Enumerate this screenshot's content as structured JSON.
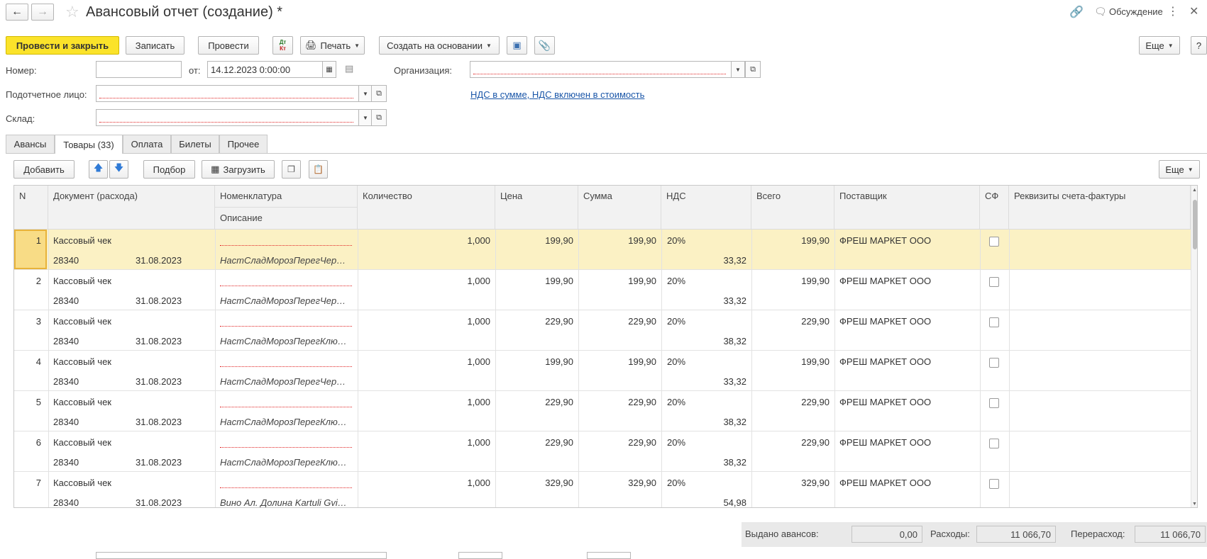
{
  "window": {
    "title": "Авансовый отчет (создание) *",
    "discussion_label": "Обсуждение"
  },
  "toolbar": {
    "post_close": "Провести и закрыть",
    "save": "Записать",
    "post": "Провести",
    "dt_kt_top": "Дт",
    "dt_kt_bottom": "Кт",
    "print": "Печать",
    "create_based": "Создать на основании",
    "more": "Еще",
    "help": "?"
  },
  "form": {
    "number_label": "Номер:",
    "number_value": "",
    "from_label": "от:",
    "date_value": "14.12.2023  0:00:00",
    "org_label": "Организация:",
    "org_value": "",
    "person_label": "Подотчетное лицо:",
    "person_value": "",
    "vat_link": "НДС в сумме, НДС включен в стоимость",
    "warehouse_label": "Склад:",
    "warehouse_value": ""
  },
  "tabs": [
    {
      "label": "Авансы",
      "active": false
    },
    {
      "label": "Товары (33)",
      "active": true
    },
    {
      "label": "Оплата",
      "active": false
    },
    {
      "label": "Билеты",
      "active": false
    },
    {
      "label": "Прочее",
      "active": false
    }
  ],
  "table_toolbar": {
    "add": "Добавить",
    "select": "Подбор",
    "load": "Загрузить",
    "more": "Еще"
  },
  "columns": {
    "n": "N",
    "doc": "Документ (расхода)",
    "nomenclature": "Номенклатура",
    "description": "Описание",
    "qty": "Количество",
    "price": "Цена",
    "sum": "Сумма",
    "vat": "НДС",
    "total": "Всего",
    "supplier": "Поставщик",
    "sf": "СФ",
    "invoice_details": "Реквизиты счета-фактуры"
  },
  "rows": [
    {
      "n": "1",
      "doc": "Кассовый чек",
      "doc_num": "28340",
      "doc_date": "31.08.2023",
      "nomenclature": "",
      "description": "НастСладМорозПерегЧер…",
      "qty": "1,000",
      "price": "199,90",
      "sum": "199,90",
      "vat_rate": "20%",
      "vat_sum": "33,32",
      "total": "199,90",
      "supplier": "ФРЕШ МАРКЕТ ООО",
      "sf": false,
      "selected": true
    },
    {
      "n": "2",
      "doc": "Кассовый чек",
      "doc_num": "28340",
      "doc_date": "31.08.2023",
      "nomenclature": "",
      "description": "НастСладМорозПерегЧер…",
      "qty": "1,000",
      "price": "199,90",
      "sum": "199,90",
      "vat_rate": "20%",
      "vat_sum": "33,32",
      "total": "199,90",
      "supplier": "ФРЕШ МАРКЕТ ООО",
      "sf": false,
      "selected": false
    },
    {
      "n": "3",
      "doc": "Кассовый чек",
      "doc_num": "28340",
      "doc_date": "31.08.2023",
      "nomenclature": "",
      "description": "НастСладМорозПерегКлю…",
      "qty": "1,000",
      "price": "229,90",
      "sum": "229,90",
      "vat_rate": "20%",
      "vat_sum": "38,32",
      "total": "229,90",
      "supplier": "ФРЕШ МАРКЕТ ООО",
      "sf": false,
      "selected": false
    },
    {
      "n": "4",
      "doc": "Кассовый чек",
      "doc_num": "28340",
      "doc_date": "31.08.2023",
      "nomenclature": "",
      "description": "НастСладМорозПерегЧер…",
      "qty": "1,000",
      "price": "199,90",
      "sum": "199,90",
      "vat_rate": "20%",
      "vat_sum": "33,32",
      "total": "199,90",
      "supplier": "ФРЕШ МАРКЕТ ООО",
      "sf": false,
      "selected": false
    },
    {
      "n": "5",
      "doc": "Кассовый чек",
      "doc_num": "28340",
      "doc_date": "31.08.2023",
      "nomenclature": "",
      "description": "НастСладМорозПерегКлю…",
      "qty": "1,000",
      "price": "229,90",
      "sum": "229,90",
      "vat_rate": "20%",
      "vat_sum": "38,32",
      "total": "229,90",
      "supplier": "ФРЕШ МАРКЕТ ООО",
      "sf": false,
      "selected": false
    },
    {
      "n": "6",
      "doc": "Кассовый чек",
      "doc_num": "28340",
      "doc_date": "31.08.2023",
      "nomenclature": "",
      "description": "НастСладМорозПерегКлю…",
      "qty": "1,000",
      "price": "229,90",
      "sum": "229,90",
      "vat_rate": "20%",
      "vat_sum": "38,32",
      "total": "229,90",
      "supplier": "ФРЕШ МАРКЕТ ООО",
      "sf": false,
      "selected": false
    },
    {
      "n": "7",
      "doc": "Кассовый чек",
      "doc_num": "28340",
      "doc_date": "31.08.2023",
      "nomenclature": "",
      "description": "Вино Ал. Долина Kartuli Gvi…",
      "qty": "1,000",
      "price": "329,90",
      "sum": "329,90",
      "vat_rate": "20%",
      "vat_sum": "54,98",
      "total": "329,90",
      "supplier": "ФРЕШ МАРКЕТ ООО",
      "sf": false,
      "selected": false
    }
  ],
  "footer": {
    "advances_label": "Выдано авансов:",
    "advances_value": "0,00",
    "expenses_label": "Расходы:",
    "expenses_value": "11 066,70",
    "overrun_label": "Перерасход:",
    "overrun_value": "11 066,70"
  },
  "colors": {
    "primary_button": "#fbe32a",
    "selected_row": "#fbf1c4",
    "link": "#1a56a8",
    "required_underline": "#e02020"
  },
  "icons": [
    "back-arrow-icon",
    "forward-arrow-icon",
    "star-icon",
    "link-icon",
    "discussion-icon",
    "printer-icon",
    "structure-icon",
    "paperclip-icon",
    "calendar-icon",
    "text-icon",
    "arrow-up-icon",
    "arrow-down-icon",
    "qr-icon",
    "copy-icon",
    "paste-icon"
  ]
}
